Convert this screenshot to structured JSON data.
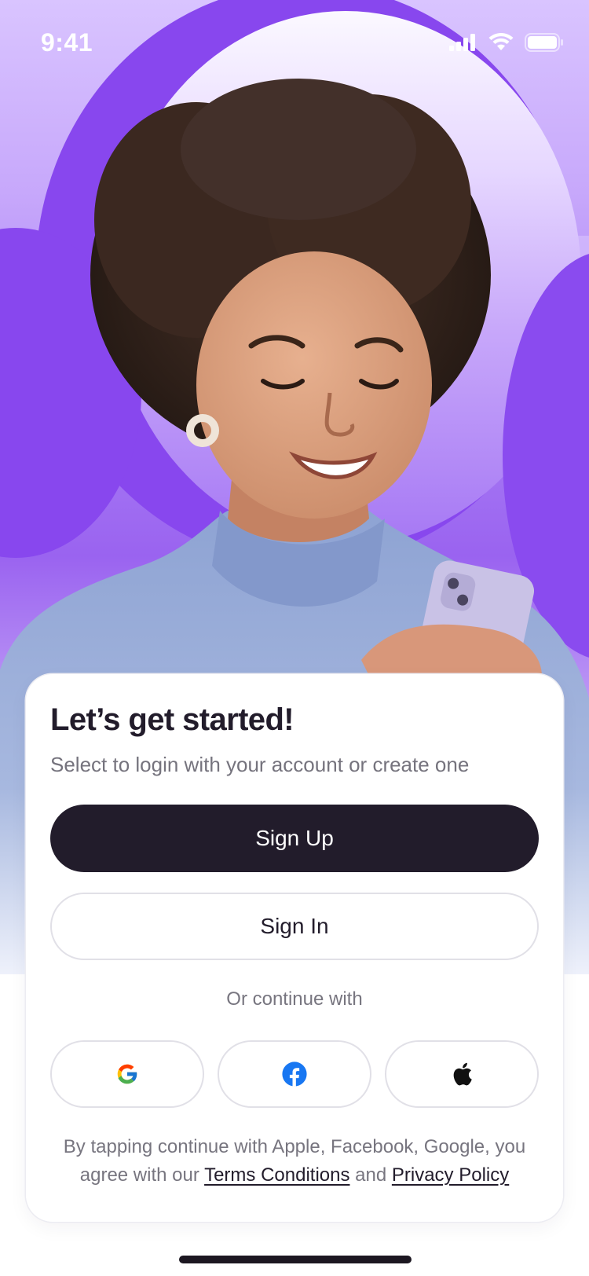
{
  "status_bar": {
    "time": "9:41",
    "icons": [
      "cellular-signal-icon",
      "wifi-icon",
      "battery-icon"
    ]
  },
  "hero": {
    "image": "smiling-woman-with-phone-photo",
    "colors": {
      "purple": "#8847ee",
      "lavender": "#dbc7ff"
    }
  },
  "onboarding": {
    "title": "Let’s get started!",
    "subtitle": "Select to login with your account or create one",
    "sign_up_label": "Sign Up",
    "sign_in_label": "Sign In",
    "divider_text": "Or continue with",
    "social": [
      {
        "name": "google",
        "icon": "google-icon"
      },
      {
        "name": "facebook",
        "icon": "facebook-icon"
      },
      {
        "name": "apple",
        "icon": "apple-icon"
      }
    ],
    "legal": {
      "line1": "By tapping continue with Apple, Facebook, Google, you",
      "line2_prefix": "agree with our",
      "terms_link": "Terms Conditions",
      "and": "and",
      "privacy_link": "Privacy Policy"
    }
  },
  "colors": {
    "primary_dark": "#221c2b",
    "muted_text": "#77757f",
    "accent_purple": "#8847ee",
    "border": "#e1e0e7"
  }
}
